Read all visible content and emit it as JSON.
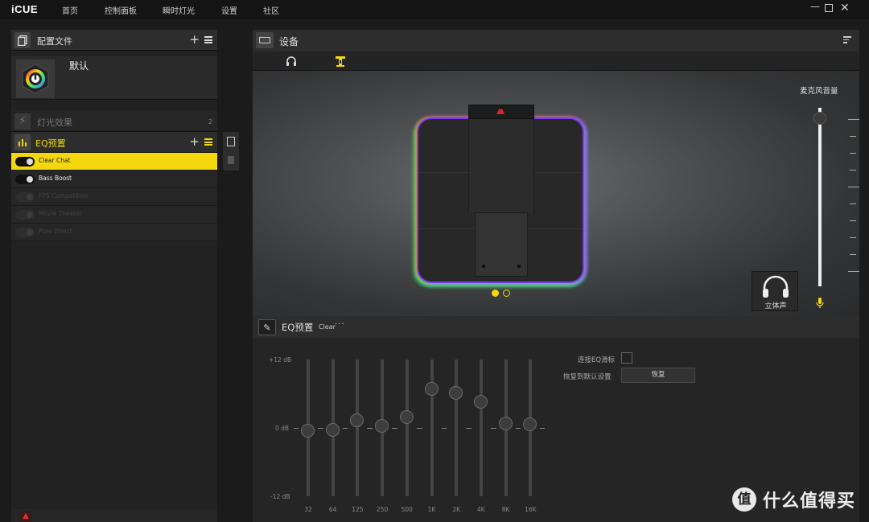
{
  "app": {
    "brand": "iCUE"
  },
  "nav": [
    "首页",
    "控制面板",
    "瞬时灯光",
    "设置",
    "社区"
  ],
  "window": {
    "minimize": "—",
    "close": "✕"
  },
  "profiles": {
    "title": "配置文件",
    "plus": "+",
    "profile_name": "默认"
  },
  "lighting": {
    "label": "灯光效果",
    "count": "2"
  },
  "eq_presets": {
    "title": "EQ预置",
    "plus": "+",
    "items": [
      "Clear Chat",
      "Bass Boost",
      "FPS Competition",
      "Movie Theater",
      "Pure Direct"
    ]
  },
  "device": {
    "title": "设备"
  },
  "mic": {
    "label": "麦克风音量",
    "level_percent": 94
  },
  "stereo": {
    "label": "立体声"
  },
  "eq_panel": {
    "title": "EQ预置",
    "preset": "Clear",
    "more": "···",
    "db_top": "+12 dB",
    "db_mid": "0 dB",
    "db_bottom": "-12 dB",
    "frequencies": [
      "32",
      "64",
      "125",
      "250",
      "500",
      "1K",
      "2K",
      "4K",
      "8K",
      "16K"
    ],
    "gains_db": [
      -0.5,
      -0.3,
      1.3,
      0.3,
      1.9,
      6.9,
      6.2,
      4.6,
      0.8,
      0.6
    ],
    "link_label": "连接EQ滑标",
    "reset_label": "恢复到默认设置",
    "reset_button": "恢复"
  },
  "watermark": {
    "logo": "值",
    "text": "什么值得买"
  },
  "colors": {
    "accent": "#f4d70c"
  }
}
